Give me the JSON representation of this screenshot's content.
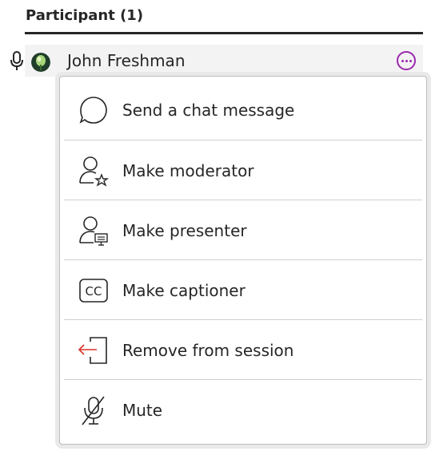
{
  "header": {
    "title": "Participant (1)"
  },
  "participant": {
    "name": "John Freshman",
    "more_icon": "more-options-icon",
    "mic_icon": "microphone-icon"
  },
  "menu": {
    "items": [
      {
        "label": "Send a chat message",
        "icon": "chat-bubble-icon"
      },
      {
        "label": "Make moderator",
        "icon": "user-star-icon"
      },
      {
        "label": "Make presenter",
        "icon": "user-presenter-icon"
      },
      {
        "label": "Make captioner",
        "icon": "closed-captions-icon"
      },
      {
        "label": "Remove from session",
        "icon": "remove-exit-icon"
      },
      {
        "label": "Mute",
        "icon": "microphone-muted-icon"
      }
    ]
  },
  "colors": {
    "accent": "#9c27b0",
    "remove_arrow": "#d9342b",
    "text": "#262626"
  }
}
